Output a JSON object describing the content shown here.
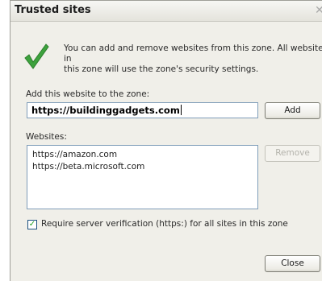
{
  "window": {
    "title": "Trusted sites"
  },
  "description": "You can add and remove websites from this zone. All websites in\nthis zone will use the zone's security settings.",
  "add_section": {
    "label": "Add this website to the zone:",
    "value": "https://buildinggadgets.com",
    "add_button": "Add"
  },
  "websites_section": {
    "label": "Websites:",
    "items": [
      "https://amazon.com",
      "https://beta.microsoft.com"
    ],
    "remove_button": "Remove"
  },
  "verification": {
    "label": "Require server verification (https:) for all sites in this zone",
    "checked": true
  },
  "close_button": "Close",
  "icons": {
    "check": "checkmark-icon",
    "close": "close-icon"
  },
  "colors": {
    "check_green": "#3da23d",
    "input_border": "#7f9db9"
  }
}
